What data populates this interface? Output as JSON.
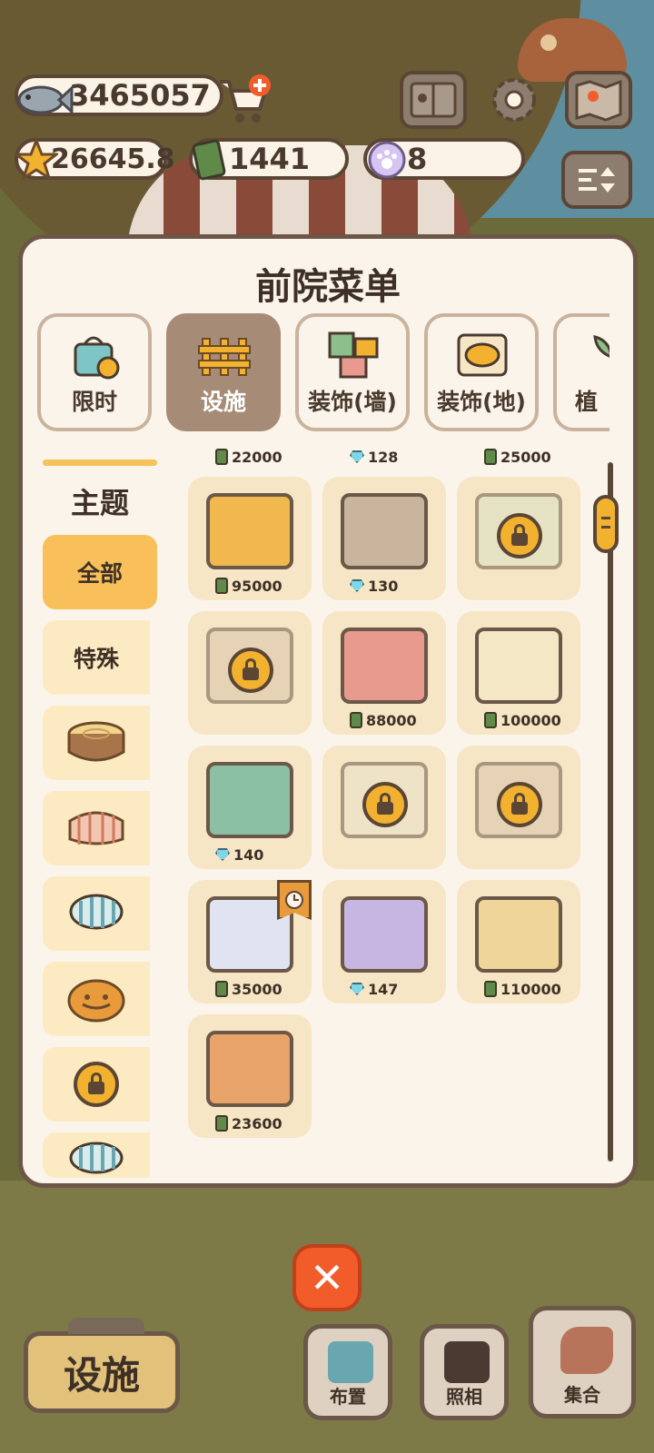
{
  "currencies": {
    "fish": "3465057",
    "star": "26645.8",
    "cash": "1441",
    "paw": "8"
  },
  "panel": {
    "title": "前院菜单",
    "tabs": [
      {
        "label": "限时",
        "active": false
      },
      {
        "label": "设施",
        "active": true
      },
      {
        "label": "装饰(墙)",
        "active": false
      },
      {
        "label": "装饰(地)",
        "active": false
      },
      {
        "label": "植",
        "active": false
      }
    ],
    "sidebar": {
      "title": "主题",
      "items": [
        {
          "label": "全部",
          "active": true
        },
        {
          "label": "特殊",
          "active": false
        },
        {
          "label": "",
          "icon": "tree-stump-icon"
        },
        {
          "label": "",
          "icon": "plaid-table-icon"
        },
        {
          "label": "",
          "icon": "striped-stool-icon"
        },
        {
          "label": "",
          "icon": "pumpkin-icon"
        },
        {
          "label": "",
          "icon": "lock-icon"
        },
        {
          "label": "",
          "icon": "striped-basket-icon"
        }
      ]
    },
    "top_row_prices": [
      {
        "currency": "cash",
        "value": "22000"
      },
      {
        "currency": "gem",
        "value": "128"
      },
      {
        "currency": "cash",
        "value": "25000"
      }
    ],
    "items": [
      {
        "currency": "cash",
        "price": "95000",
        "locked": false,
        "art_color": "#f1b84e"
      },
      {
        "currency": "gem",
        "price": "130",
        "locked": false,
        "art_color": "#c9b49e"
      },
      {
        "currency": "",
        "price": "",
        "locked": true,
        "art_color": "#d8e2c4"
      },
      {
        "currency": "",
        "price": "",
        "locked": true,
        "art_color": "#d9c4a8"
      },
      {
        "currency": "cash",
        "price": "88000",
        "locked": false,
        "art_color": "#e99a8f"
      },
      {
        "currency": "cash",
        "price": "100000",
        "locked": false,
        "art_color": "#f3e7c6"
      },
      {
        "currency": "gem",
        "price": "140",
        "locked": false,
        "art_color": "#8cc0a4"
      },
      {
        "currency": "",
        "price": "",
        "locked": true,
        "art_color": "#e7dfc9"
      },
      {
        "currency": "",
        "price": "",
        "locked": true,
        "art_color": "#d9c4a8"
      },
      {
        "currency": "cash",
        "price": "35000",
        "locked": false,
        "timed": true,
        "art_color": "#dfe4f0"
      },
      {
        "currency": "gem",
        "price": "147",
        "locked": false,
        "art_color": "#c7b5e2"
      },
      {
        "currency": "cash",
        "price": "110000",
        "locked": false,
        "art_color": "#f0d59a"
      },
      {
        "currency": "cash",
        "price": "23600",
        "locked": false,
        "art_color": "#e8a36a"
      }
    ]
  },
  "bottom": {
    "main": "设施",
    "buttons": [
      "布置",
      "照相",
      "集合"
    ]
  },
  "colors": {
    "accent": "#f2b230",
    "panel_bg": "#fbf4ea",
    "active_tab": "#a68b76",
    "close": "#f25c2a"
  }
}
